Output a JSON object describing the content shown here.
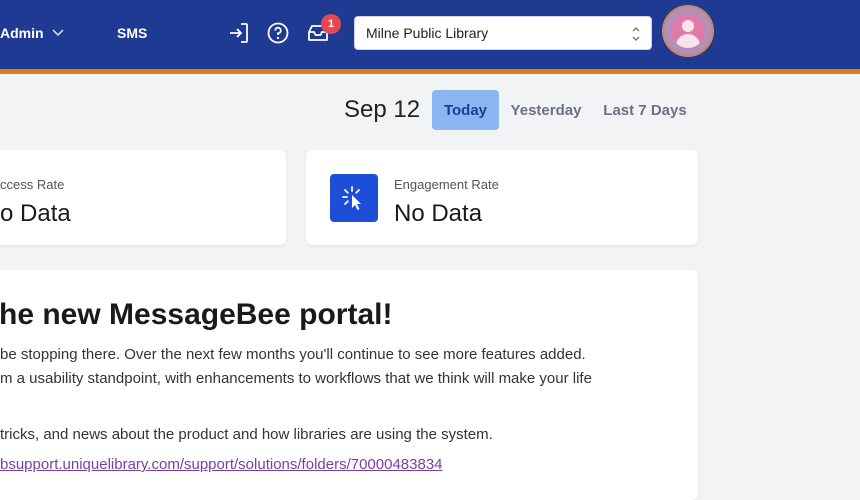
{
  "header": {
    "admin_label": "Admin",
    "sms_label": "SMS",
    "notification_count": "1",
    "library_select": "Milne Public Library"
  },
  "date_filter": {
    "date": "Sep 12",
    "tabs": [
      {
        "label": "Today",
        "active": true
      },
      {
        "label": "Yesterday",
        "active": false
      },
      {
        "label": "Last 7 Days",
        "active": false
      }
    ]
  },
  "stats": {
    "success": {
      "label": "ccess Rate",
      "value": "o Data"
    },
    "engagement": {
      "label": "Engagement Rate",
      "value": "No Data"
    }
  },
  "welcome": {
    "title": "he new MessageBee portal!",
    "line1": "be stopping there.  Over the next few months you'll continue to see more features added.",
    "line2": "m a usability standpoint, with enhancements to workflows that we think will make your life",
    "line3": "tricks, and news about the product and how libraries are using the system.",
    "link": "bsupport.uniquelibrary.com/support/solutions/folders/70000483834"
  },
  "colors": {
    "header_bg": "#1f3a93",
    "accent_orange": "#e07b16",
    "active_tab": "#8cb6f2",
    "icon_blue": "#1d4ed8",
    "link": "#7b3fa3"
  }
}
